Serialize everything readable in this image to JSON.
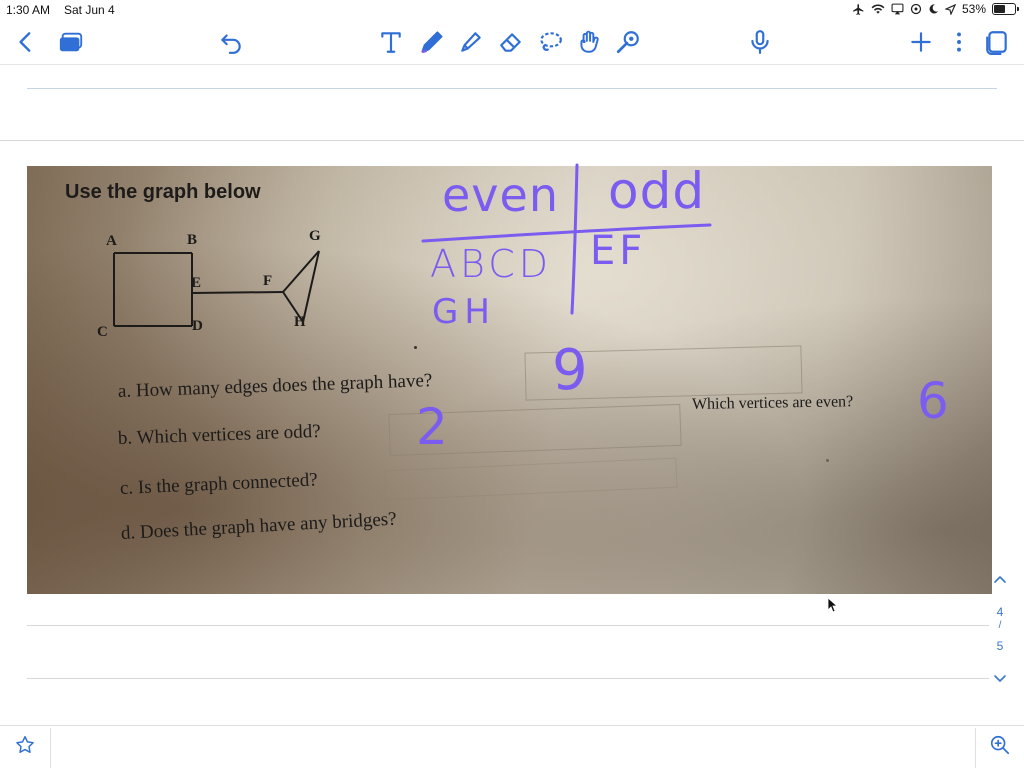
{
  "status_bar": {
    "time": "1:30 AM",
    "date": "Sat Jun 4",
    "battery_percent": "53%",
    "battery_level": 0.53,
    "icons": [
      "airplane-icon",
      "wifi-icon",
      "screen-mirror-icon",
      "location-icon",
      "moon-icon",
      "arrow-icon"
    ]
  },
  "toolbar": {
    "left": [
      "back-chevron-icon",
      "thumbnails-icon",
      "undo-icon"
    ],
    "tools": [
      "text-tool-icon",
      "pen-tool-icon",
      "highlighter-tool-icon",
      "eraser-tool-icon",
      "lasso-tool-icon",
      "hand-tool-icon",
      "shapes-tool-icon"
    ],
    "right": [
      "microphone-icon",
      "add-page-icon",
      "more-options-icon",
      "document-icon"
    ],
    "accent": "#2f6fd6"
  },
  "worksheet": {
    "heading": "Use the graph below",
    "vertices": [
      "A",
      "B",
      "C",
      "D",
      "E",
      "F",
      "G",
      "H"
    ],
    "questions": [
      {
        "label": "a.",
        "text": "How many edges does the graph have?"
      },
      {
        "label": "b.",
        "text": "Which vertices are odd?"
      },
      {
        "label": "c.",
        "text": "Is the graph connected?"
      },
      {
        "label": "d.",
        "text": "Does the graph have any bridges?"
      }
    ],
    "extra_question": "Which vertices are even?"
  },
  "handwriting": {
    "col_even": "even",
    "col_odd": "odd",
    "even_row1": "ABCD",
    "even_row2": "GH",
    "odd_row1": "EF",
    "answer_edges": "9",
    "answer_odd": "2",
    "answer_even": "6",
    "ink_color": "#7b5cf0"
  },
  "pager": {
    "current": "4",
    "separator": "/",
    "total": "5"
  }
}
